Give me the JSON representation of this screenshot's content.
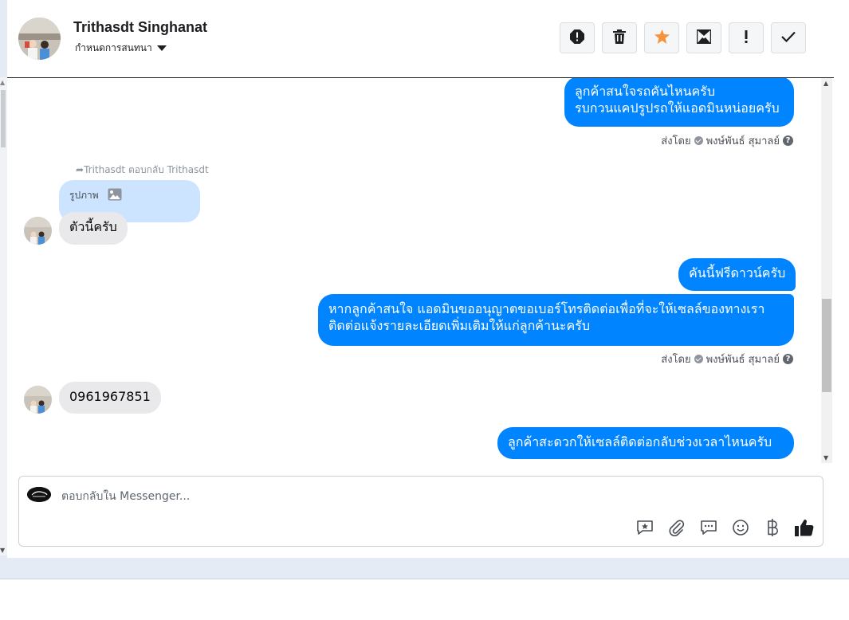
{
  "header": {
    "name": "Trithasdt Singhanat",
    "assign_label": "กำหนดการสนทนา",
    "actions": [
      "spam-alert-icon",
      "trash-icon",
      "star-icon",
      "mark-unread-icon",
      "exclamation-icon",
      "check-icon"
    ]
  },
  "messages": {
    "m1_line1": "ลูกค้าสนใจรถคันไหนครับ",
    "m1_line2": "รบกวนแคปรูปรถให้แอดมินหน่อยครับ",
    "sent_by_1": "ส่งโดย",
    "sender_1": "พงษ์พันธ์ สุมาลย์",
    "reply_hint": "Trithasdt ตอบกลับ Trithasdt",
    "reply_quote": "รูปภาพ",
    "m2": "ตัวนี้ครับ",
    "m3": "คันนี้ฟรีดาวน์ครับ",
    "m4_line1": "หากลูกค้าสนใจ แอดมินขออนุญาตขอเบอร์โทรติดต่อเพื่อที่จะให้เซลล์ของทางเรา",
    "m4_line2": "ติดต่อแจ้งรายละเอียดเพิ่มเติมให้แก่ลูกค้านะครับ",
    "sent_by_2": "ส่งโดย",
    "sender_2": "พงษ์พันธ์ สุมาลย์",
    "m5": "0961967851",
    "m6": "ลูกค้าสะดวกให้เซลล์ติดต่อกลับช่วงเวลาไหนครับ"
  },
  "composer": {
    "placeholder": "ตอบกลับใน Messenger...",
    "tools": [
      "saved-reply-icon",
      "attachment-icon",
      "chat-bubble-icon",
      "emoji-icon",
      "baht-icon",
      "like-icon"
    ]
  },
  "colors": {
    "outgoing": "#0084ff",
    "incoming": "#e9e9eb",
    "quote": "#cce4ff",
    "star": "#f7923b"
  }
}
